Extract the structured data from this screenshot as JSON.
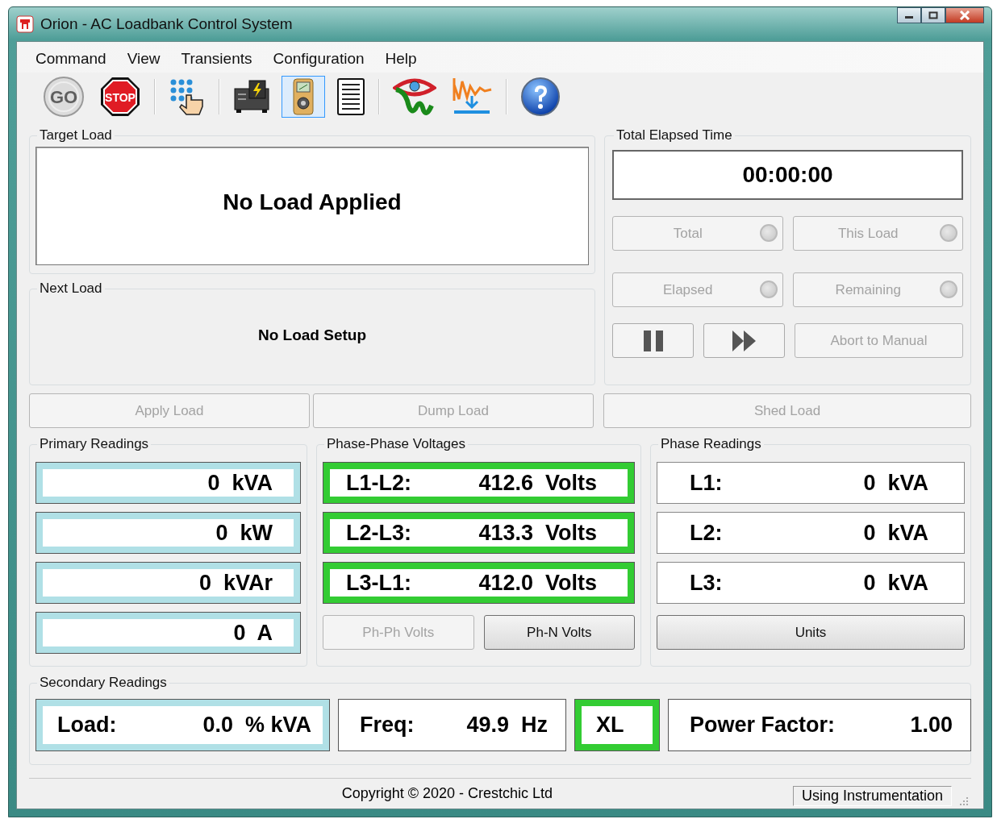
{
  "window": {
    "title": "Orion - AC Loadbank Control System"
  },
  "menu": [
    {
      "label": "Command"
    },
    {
      "label": "View"
    },
    {
      "label": "Transients"
    },
    {
      "label": "Configuration"
    },
    {
      "label": "Help"
    }
  ],
  "toolbar": [
    {
      "items": [
        {
          "kind": "go",
          "label": "GO",
          "disabled": true,
          "selected": false
        },
        {
          "kind": "stop",
          "label": "STOP",
          "selected": false
        }
      ]
    },
    {
      "items": [
        {
          "kind": "keypad",
          "selected": false
        }
      ]
    },
    {
      "items": [
        {
          "kind": "generator",
          "selected": false
        },
        {
          "kind": "meter",
          "selected": true
        },
        {
          "kind": "document",
          "selected": false
        }
      ]
    },
    {
      "items": [
        {
          "kind": "eye",
          "selected": false
        },
        {
          "kind": "wave",
          "selected": false
        }
      ]
    },
    {
      "items": [
        {
          "kind": "help",
          "selected": false
        }
      ]
    }
  ],
  "target_load": {
    "title": "Target Load",
    "text": "No Load Applied"
  },
  "next_load": {
    "title": "Next Load",
    "text": "No Load Setup"
  },
  "elapsed": {
    "title": "Total Elapsed Time",
    "time": "00:00:00",
    "toggles": [
      {
        "label": "Total",
        "on": false,
        "disabled": true
      },
      {
        "label": "This Load",
        "on": false,
        "disabled": true
      },
      {
        "label": "Elapsed",
        "on": false,
        "disabled": true
      },
      {
        "label": "Remaining",
        "on": false,
        "disabled": true
      }
    ],
    "abort": {
      "label": "Abort to Manual",
      "disabled": true
    }
  },
  "actions": [
    {
      "label": "Apply Load",
      "disabled": true
    },
    {
      "label": "Dump Load",
      "disabled": true
    },
    {
      "label": "Shed Load",
      "disabled": true
    }
  ],
  "primary": {
    "title": "Primary Readings",
    "rows": [
      {
        "reading": "0  kVA",
        "color": "#b0e0e6"
      },
      {
        "reading": "0  kW",
        "color": "#b0e0e6"
      },
      {
        "reading": "0  kVAr",
        "color": "#b0e0e6"
      },
      {
        "reading": "0  A",
        "color": "#b0e0e6"
      }
    ]
  },
  "phase_phase": {
    "title": "Phase-Phase Voltages",
    "rows": [
      {
        "label": "L1-L2:",
        "reading": "412.6  Volts",
        "color": "#33cc33"
      },
      {
        "label": "L2-L3:",
        "reading": "413.3  Volts",
        "color": "#33cc33"
      },
      {
        "label": "L3-L1:",
        "reading": "412.0  Volts",
        "color": "#33cc33"
      }
    ],
    "buttons": [
      {
        "label": "Ph-Ph Volts",
        "disabled": true
      },
      {
        "label": "Ph-N Volts",
        "disabled": false
      }
    ]
  },
  "phase": {
    "title": "Phase Readings",
    "rows": [
      {
        "label": "L1:",
        "reading": "0  kVA"
      },
      {
        "label": "L2:",
        "reading": "0  kVA"
      },
      {
        "label": "L3:",
        "reading": "0  kVA"
      }
    ],
    "buttons": [
      {
        "label": "Units",
        "disabled": false
      }
    ]
  },
  "secondary": {
    "title": "Secondary Readings",
    "items": [
      {
        "label": "Load:",
        "reading": "0.0  % kVA",
        "color": "#b0e0e6"
      },
      {
        "label": "Freq:",
        "reading": "49.9  Hz"
      },
      {
        "label": "XL",
        "color": "#33cc33"
      },
      {
        "label": "Power Factor:",
        "reading": "1.00"
      }
    ]
  },
  "status_bar": {
    "copyright": "Copyright © 2020 - Crestchic Ltd",
    "mode": "Using Instrumentation"
  }
}
